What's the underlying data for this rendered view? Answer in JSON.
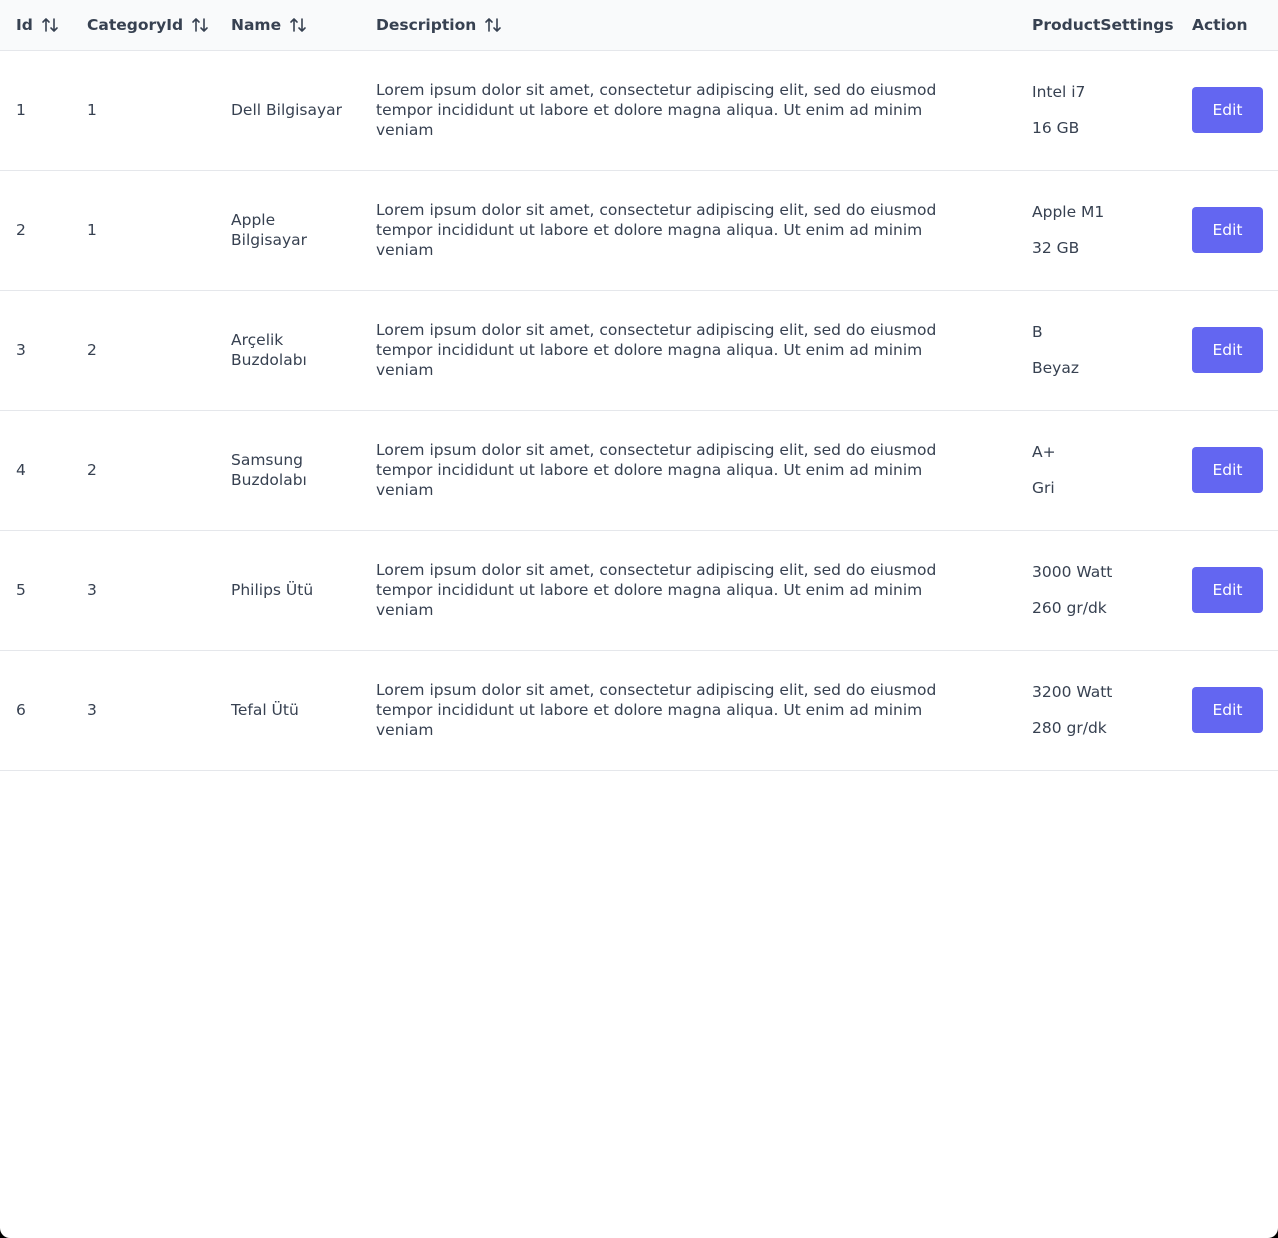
{
  "colors": {
    "accent": "#6366f1",
    "header_bg": "#f9fafb",
    "border": "#e5e7eb",
    "text": "#374151"
  },
  "table": {
    "columns": [
      {
        "label": "Id",
        "sortable": true
      },
      {
        "label": "CategoryId",
        "sortable": true
      },
      {
        "label": "Name",
        "sortable": true
      },
      {
        "label": "Description",
        "sortable": true
      },
      {
        "label": "ProductSettings",
        "sortable": false
      },
      {
        "label": "Action",
        "sortable": false
      }
    ],
    "rows": [
      {
        "id": "1",
        "category_id": "1",
        "name": "Dell Bilgisayar",
        "description": "Lorem ipsum dolor sit amet, consectetur adipiscing elit, sed do eiusmod tempor incididunt ut labore et dolore magna aliqua. Ut enim ad minim veniam",
        "settings": [
          "Intel i7",
          "16 GB"
        ],
        "action_label": "Edit"
      },
      {
        "id": "2",
        "category_id": "1",
        "name": "Apple Bilgisayar",
        "description": "Lorem ipsum dolor sit amet, consectetur adipiscing elit, sed do eiusmod tempor incididunt ut labore et dolore magna aliqua. Ut enim ad minim veniam",
        "settings": [
          "Apple M1",
          "32 GB"
        ],
        "action_label": "Edit"
      },
      {
        "id": "3",
        "category_id": "2",
        "name": "Arçelik Buzdolabı",
        "description": "Lorem ipsum dolor sit amet, consectetur adipiscing elit, sed do eiusmod tempor incididunt ut labore et dolore magna aliqua. Ut enim ad minim veniam",
        "settings": [
          "B",
          "Beyaz"
        ],
        "action_label": "Edit"
      },
      {
        "id": "4",
        "category_id": "2",
        "name": "Samsung Buzdolabı",
        "description": "Lorem ipsum dolor sit amet, consectetur adipiscing elit, sed do eiusmod tempor incididunt ut labore et dolore magna aliqua. Ut enim ad minim veniam",
        "settings": [
          "A+",
          "Gri"
        ],
        "action_label": "Edit"
      },
      {
        "id": "5",
        "category_id": "3",
        "name": "Philips Ütü",
        "description": "Lorem ipsum dolor sit amet, consectetur adipiscing elit, sed do eiusmod tempor incididunt ut labore et dolore magna aliqua. Ut enim ad minim veniam",
        "settings": [
          "3000 Watt",
          "260 gr/dk"
        ],
        "action_label": "Edit"
      },
      {
        "id": "6",
        "category_id": "3",
        "name": "Tefal Ütü",
        "description": "Lorem ipsum dolor sit amet, consectetur adipiscing elit, sed do eiusmod tempor incididunt ut labore et dolore magna aliqua. Ut enim ad minim veniam",
        "settings": [
          "3200 Watt",
          "280 gr/dk"
        ],
        "action_label": "Edit"
      }
    ]
  }
}
